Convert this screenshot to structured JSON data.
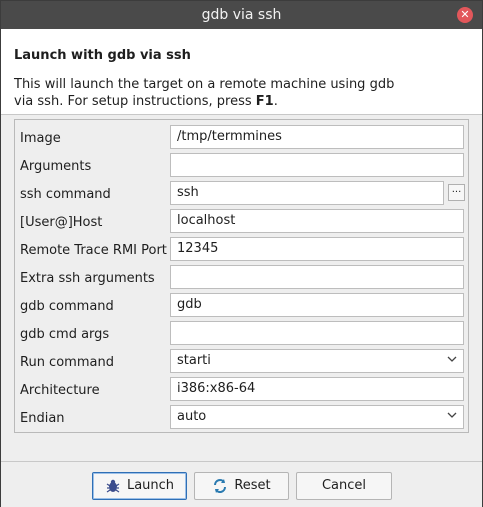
{
  "window": {
    "title": "gdb via ssh"
  },
  "header": {
    "heading": "Launch with gdb via ssh",
    "description_line1": "This will launch the target on a remote machine using gdb",
    "description_line2_prefix": "via ssh. For setup instructions, press ",
    "description_key": "F1",
    "description_suffix": "."
  },
  "form": {
    "image": {
      "label": "Image",
      "value": "/tmp/termmines"
    },
    "arguments": {
      "label": "Arguments",
      "value": ""
    },
    "ssh_command": {
      "label": "ssh command",
      "value": "ssh",
      "browse_label": "..."
    },
    "host": {
      "label": "[User@]Host",
      "value": "localhost"
    },
    "rmi_port": {
      "label": "Remote Trace RMI Port",
      "value": "12345"
    },
    "extra_ssh": {
      "label": "Extra ssh arguments",
      "value": ""
    },
    "gdb_command": {
      "label": "gdb command",
      "value": "gdb"
    },
    "gdb_args": {
      "label": "gdb cmd args",
      "value": ""
    },
    "run_command": {
      "label": "Run command",
      "value": "starti"
    },
    "architecture": {
      "label": "Architecture",
      "value": "i386:x86-64"
    },
    "endian": {
      "label": "Endian",
      "value": "auto"
    }
  },
  "footer": {
    "launch_label": "Launch",
    "reset_label": "Reset",
    "cancel_label": "Cancel"
  },
  "colors": {
    "titlebar": "#4a4a4a",
    "close": "#e2575b",
    "primary_border": "#2f6fb5"
  },
  "icons": {
    "close": "close-icon",
    "launch": "bug-icon",
    "reset": "refresh-icon",
    "dropdown": "chevron-down-icon"
  }
}
